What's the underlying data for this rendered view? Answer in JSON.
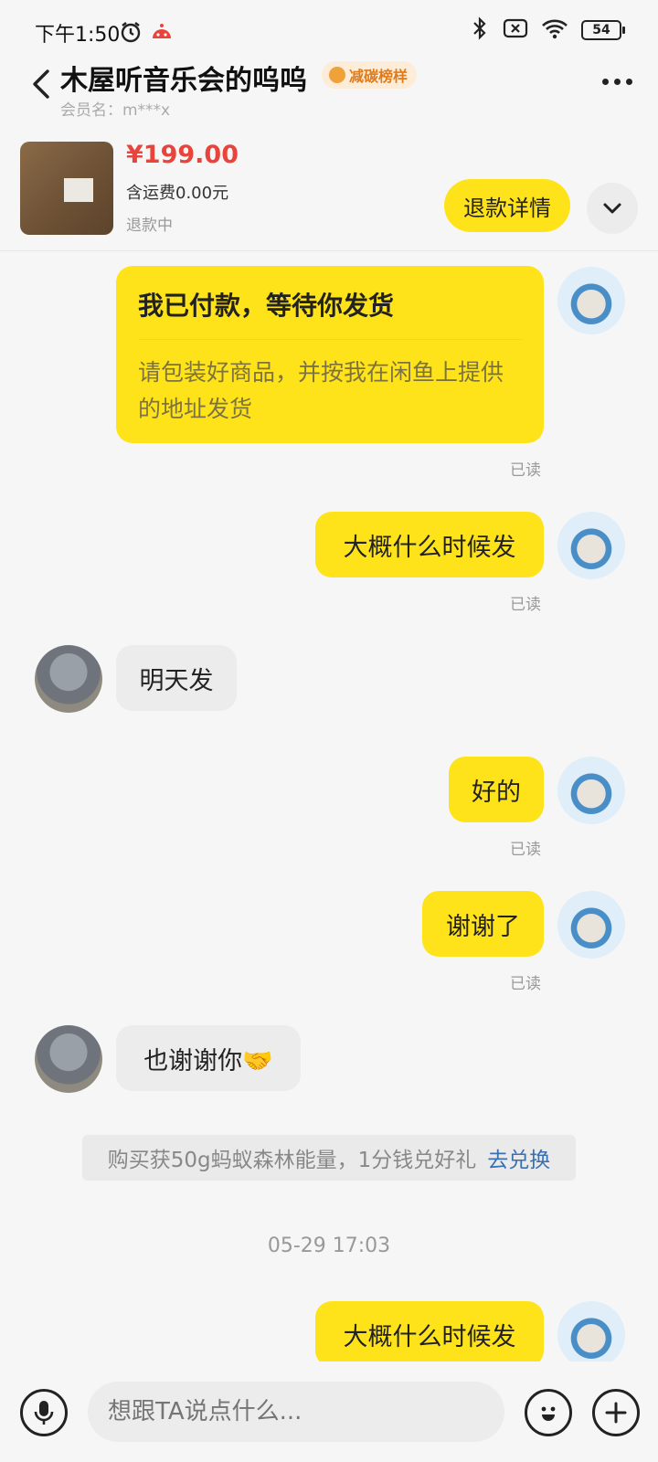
{
  "status_bar": {
    "time": "下午1:50",
    "battery": "54"
  },
  "header": {
    "back_icon": "chevron-left-icon",
    "title": "木屋听音乐会的呜呜",
    "badge": "减碳榜样",
    "member": "会员名：m***x",
    "more_icon": "more-dots-icon"
  },
  "product": {
    "price": "¥199.00",
    "shipping": "含运费0.00元",
    "status": "退款中",
    "refund_button": "退款详情",
    "expand_icon": "chevron-down-icon"
  },
  "messages": {
    "card": {
      "title": "我已付款，等待你发货",
      "body": "请包装好商品，并按我在闲鱼上提供的地址发货",
      "read": "已读"
    },
    "m1": {
      "text": "大概什么时候发",
      "read": "已读"
    },
    "m2": {
      "text": "明天发"
    },
    "m3": {
      "text": "好的",
      "read": "已读"
    },
    "m4": {
      "text": "谢谢了",
      "read": "已读"
    },
    "m5": {
      "text": "也谢谢你🤝"
    },
    "notice": {
      "text": "购买获50g蚂蚁森林能量，1分钱兑好礼",
      "link": "去兑换"
    },
    "timestamp": "05-29 17:03",
    "m6": {
      "text": "大概什么时候发"
    }
  },
  "input": {
    "placeholder": "想跟TA说点什么...",
    "mic_icon": "microphone-icon",
    "emoji_icon": "emoji-icon",
    "plus_icon": "plus-icon"
  },
  "colors": {
    "accent": "#ffe31a",
    "price": "#e8443b",
    "link": "#3a6fb0"
  }
}
